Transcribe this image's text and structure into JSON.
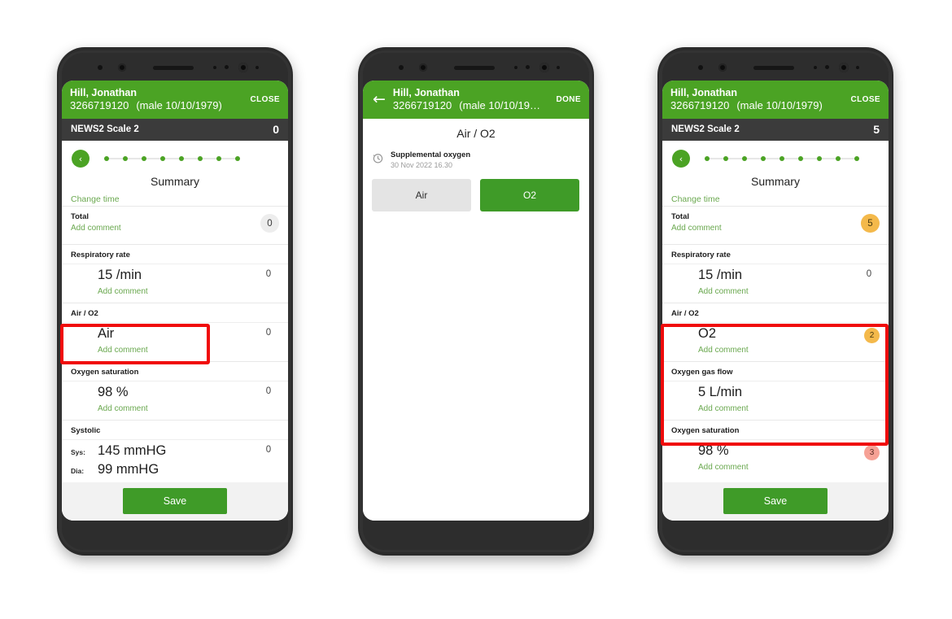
{
  "app": {
    "brand_green": "#4ba324",
    "header_dark": "#3b3b3b",
    "highlight_red": "#f00b0b"
  },
  "patient": {
    "name": "Hill, Jonathan",
    "id": "3266719120",
    "meta": "(male 10/10/1979)",
    "meta_truncated": "(male 10/10/19…"
  },
  "labels": {
    "close": "CLOSE",
    "done": "DONE",
    "back_arrow": "←",
    "chevron_left": "‹",
    "summary": "Summary",
    "change_time": "Change time",
    "total": "Total",
    "add_comment": "Add comment",
    "save": "Save",
    "news2_scale": "NEWS2 Scale 2"
  },
  "phone1": {
    "score_total": "0",
    "steps": 8,
    "rows": [
      {
        "name": "Total",
        "value": "",
        "comment": "Add comment",
        "score": "0",
        "badge": "grey"
      },
      {
        "name": "Respiratory rate",
        "value": "15 /min",
        "comment": "Add comment",
        "score": "0",
        "badge": "plain"
      },
      {
        "name": "Air / O2",
        "value": "Air",
        "comment": "Add comment",
        "score": "0",
        "badge": "plain"
      },
      {
        "name": "Oxygen saturation",
        "value": "98 %",
        "comment": "Add comment",
        "score": "0",
        "badge": "plain"
      },
      {
        "name": "Systolic",
        "sys_tag": "Sys:",
        "sys_value": "145 mmHG",
        "dia_tag": "Dia:",
        "dia_value": "99 mmHG",
        "score": "0",
        "badge": "plain"
      }
    ]
  },
  "phone2": {
    "screen_title": "Air / O2",
    "supplemental_label": "Supplemental oxygen",
    "supplemental_date": "30 Nov 2022 16.30",
    "options": [
      {
        "label": "Air",
        "selected": false
      },
      {
        "label": "O2",
        "selected": true
      }
    ]
  },
  "phone3": {
    "score_total": "5",
    "steps": 9,
    "rows": [
      {
        "name": "Total",
        "value": "",
        "comment": "Add comment",
        "score": "5",
        "badge": "amber"
      },
      {
        "name": "Respiratory rate",
        "value": "15 /min",
        "comment": "Add comment",
        "score": "0",
        "badge": "plain"
      },
      {
        "name": "Air / O2",
        "value": "O2",
        "comment": "Add comment",
        "score": "2",
        "badge": "amber"
      },
      {
        "name": "Oxygen gas flow",
        "value": "5 L/min",
        "comment": "Add comment",
        "score": "",
        "badge": "none"
      },
      {
        "name": "Oxygen saturation",
        "value": "98 %",
        "comment": "Add comment",
        "score": "3",
        "badge": "salmon"
      }
    ]
  }
}
